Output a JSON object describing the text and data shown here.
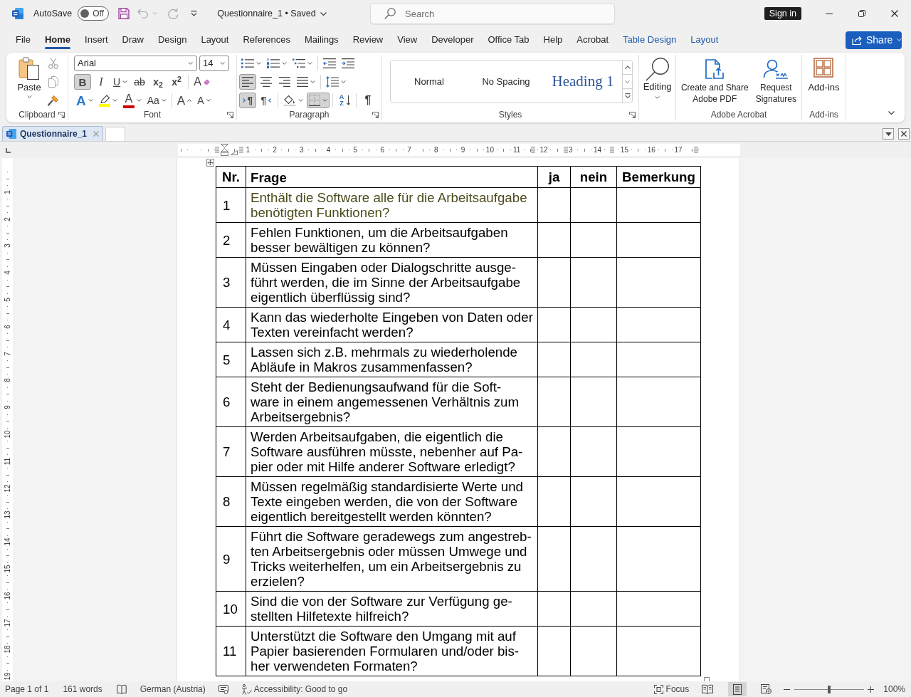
{
  "title_bar": {
    "autosave_label": "AutoSave",
    "autosave": {
      "on": false,
      "text": "Off"
    },
    "quick_access": [
      {
        "kind": "save",
        "disabled": false
      },
      {
        "kind": "undo",
        "disabled": true
      },
      {
        "kind": "redo",
        "disabled": true
      }
    ],
    "document_title": "Questionnaire_1 • Saved",
    "search": {
      "placeholder": "Search"
    },
    "sign_in": "Sign in"
  },
  "menu_tabs": [
    {
      "label": "File",
      "selected": false,
      "contextual": false
    },
    {
      "label": "Home",
      "selected": true,
      "contextual": false
    },
    {
      "label": "Insert",
      "selected": false,
      "contextual": false
    },
    {
      "label": "Draw",
      "selected": false,
      "contextual": false
    },
    {
      "label": "Design",
      "selected": false,
      "contextual": false
    },
    {
      "label": "Layout",
      "selected": false,
      "contextual": false
    },
    {
      "label": "References",
      "selected": false,
      "contextual": false
    },
    {
      "label": "Mailings",
      "selected": false,
      "contextual": false
    },
    {
      "label": "Review",
      "selected": false,
      "contextual": false
    },
    {
      "label": "View",
      "selected": false,
      "contextual": false
    },
    {
      "label": "Developer",
      "selected": false,
      "contextual": false
    },
    {
      "label": "Office Tab",
      "selected": false,
      "contextual": false
    },
    {
      "label": "Help",
      "selected": false,
      "contextual": false
    },
    {
      "label": "Acrobat",
      "selected": false,
      "contextual": false
    },
    {
      "label": "Table Design",
      "selected": false,
      "contextual": true
    },
    {
      "label": "Layout",
      "selected": false,
      "contextual": true
    }
  ],
  "share": "Share",
  "ribbon": {
    "clipboard": {
      "label": "Clipboard",
      "paste": "Paste",
      "tools": [
        {
          "kind": "cut",
          "disabled": true
        },
        {
          "kind": "copy",
          "disabled": true
        },
        {
          "kind": "format_painter",
          "disabled": false
        }
      ]
    },
    "font": {
      "label": "Font",
      "font_name": "Arial",
      "font_size": "14",
      "second_row": [
        {
          "kind": "bold",
          "glyph": "B",
          "on": true
        },
        {
          "kind": "italic",
          "glyph": "I",
          "on": false
        },
        {
          "kind": "underline",
          "glyph": "U",
          "on": false
        },
        {
          "kind": "strikethrough",
          "glyph": "ab",
          "on": false
        },
        {
          "kind": "subscript",
          "glyph": "x$_{2}$",
          "on": false
        },
        {
          "kind": "superscript",
          "glyph": "x$^{2}$",
          "on": false
        },
        {
          "kind": "clear_formatting",
          "glyph": "A",
          "on": false
        }
      ],
      "third_row": [
        {
          "kind": "text_effects",
          "glyph": "A",
          "on": false
        },
        {
          "kind": "highlight",
          "color": "#ffff00",
          "on": false
        },
        {
          "kind": "font_color",
          "glyph": "A",
          "color": "#d40000",
          "on": false
        },
        {
          "kind": "change_case",
          "glyph": "Aa",
          "on": false
        },
        {
          "kind": "grow_font",
          "glyph": "A",
          "on": false
        },
        {
          "kind": "shrink_font",
          "glyph": "A",
          "on": false
        }
      ]
    },
    "paragraph": {
      "label": "Paragraph",
      "first_row": [
        {
          "kind": "bullets",
          "on": false
        },
        {
          "kind": "numbering",
          "on": false
        },
        {
          "kind": "multilevel",
          "on": false
        },
        {
          "kind": "decrease_indent",
          "on": false
        },
        {
          "kind": "increase_indent",
          "on": false
        }
      ],
      "second_row": [
        {
          "kind": "align_left",
          "on": true
        },
        {
          "kind": "align_center",
          "on": false
        },
        {
          "kind": "align_right",
          "on": false
        },
        {
          "kind": "justify",
          "on": false
        },
        {
          "kind": "line_spacing",
          "on": false
        }
      ],
      "third_row": [
        {
          "kind": "left_to_right",
          "glyph": "¶",
          "on": true
        },
        {
          "kind": "right_to_left",
          "glyph": "¶",
          "on": false
        },
        {
          "kind": "shading",
          "on": false
        },
        {
          "kind": "borders",
          "on": true
        },
        {
          "kind": "sort",
          "glyph": "AZ",
          "on": false
        },
        {
          "kind": "show_marks",
          "glyph": "¶",
          "on": false
        }
      ]
    },
    "styles": {
      "label": "Styles",
      "items": [
        {
          "name": "Normal",
          "kind": "normal"
        },
        {
          "name": "No Spacing",
          "kind": "normal"
        },
        {
          "name": "Heading 1",
          "kind": "heading"
        }
      ]
    },
    "editing": {
      "label": "Editing"
    },
    "adobe": {
      "label": "Adobe Acrobat",
      "buttons": [
        {
          "kind": "create_pdf",
          "label": "Create and Share\nAdobe PDF"
        },
        {
          "kind": "request_signatures",
          "label": "Request\nSignatures"
        }
      ]
    },
    "addins": {
      "label": "Add-ins",
      "button": "Add-ins"
    }
  },
  "document_tabs": [
    {
      "label": "Questionnaire_1",
      "selected": true
    }
  ],
  "horizontal_ruler": {
    "labels": [
      "1",
      "2",
      "3",
      "4",
      "5",
      "6",
      "7",
      "8",
      "9",
      "10",
      "11",
      "12",
      "3",
      "14",
      "15",
      "16",
      "17"
    ]
  },
  "vertical_ruler": {
    "labels": [
      "1",
      "2",
      "3",
      "4",
      "5",
      "6",
      "7",
      "8",
      "9",
      "10",
      "11",
      "12",
      "13",
      "14",
      "15",
      "16",
      "17",
      "18",
      "19"
    ]
  },
  "table": {
    "columns": [
      "Nr.",
      "Frage",
      "ja",
      "nein",
      "Bemerkung"
    ],
    "rows": [
      {
        "nr": "1",
        "frage": "Enthält die Software alle für die Arbeitsaufgabe\nbenötigten Funktionen?",
        "color": "#4d4a1b"
      },
      {
        "nr": "2",
        "frage": "Fehlen Funktionen, um die Arbeitsaufgaben\nbesser bewältigen zu können?",
        "color": "#000000"
      },
      {
        "nr": "3",
        "frage": "Müssen Eingaben oder Dialogschritte ausge-\nführt werden, die im Sinne der Arbeitsaufgabe\neigentlich überflüssig sind?",
        "color": "#000000"
      },
      {
        "nr": "4",
        "frage": "Kann das wiederholte Eingeben von Daten oder\nTexten vereinfacht werden?",
        "color": "#000000"
      },
      {
        "nr": "5",
        "frage": "Lassen sich z.B. mehrmals zu wiederholende\nAbläufe in Makros zusammenfassen?",
        "color": "#000000"
      },
      {
        "nr": "6",
        "frage": "Steht der Bedienungsaufwand für die Soft-\nware in einem angemessenen Verhältnis zum\nArbeitsergebnis?",
        "color": "#000000"
      },
      {
        "nr": "7",
        "frage": "Werden Arbeitsaufgaben, die eigentlich die\nSoftware ausführen müsste, nebenher auf Pa-\npier oder mit Hilfe anderer Software erledigt?",
        "color": "#000000"
      },
      {
        "nr": "8",
        "frage": "Müssen regelmäßig standardisierte Werte und\nTexte eingeben werden, die von der Software\neigentlich bereitgestellt werden könnten?",
        "color": "#000000"
      },
      {
        "nr": "9",
        "frage": "Führt die Software geradewegs zum angestreb-\nten Arbeitsergebnis oder müssen Umwege und\nTricks weiterhelfen, um ein Arbeitsergebnis zu\nerzielen?",
        "color": "#000000"
      },
      {
        "nr": "10",
        "frage": "Sind die von der Software zur Verfügung ge-\nstellten Hilfetexte hilfreich?",
        "color": "#000000"
      },
      {
        "nr": "11",
        "frage": "Unterstützt die Software den Umgang mit auf\nPapier basierenden Formularen und/oder bis-\nher verwendeten Formaten?",
        "color": "#000000"
      }
    ]
  },
  "status_bar": {
    "page": "Page 1 of 1",
    "words": "161 words",
    "language": "German (Austria)",
    "accessibility": "Accessibility: Good to go",
    "focus": "Focus",
    "views": [
      {
        "kind": "read_mode",
        "selected": false
      },
      {
        "kind": "print_layout",
        "selected": true
      },
      {
        "kind": "web_layout",
        "selected": false
      }
    ],
    "zoom": {
      "level": 0.5,
      "reading": "100%"
    }
  }
}
